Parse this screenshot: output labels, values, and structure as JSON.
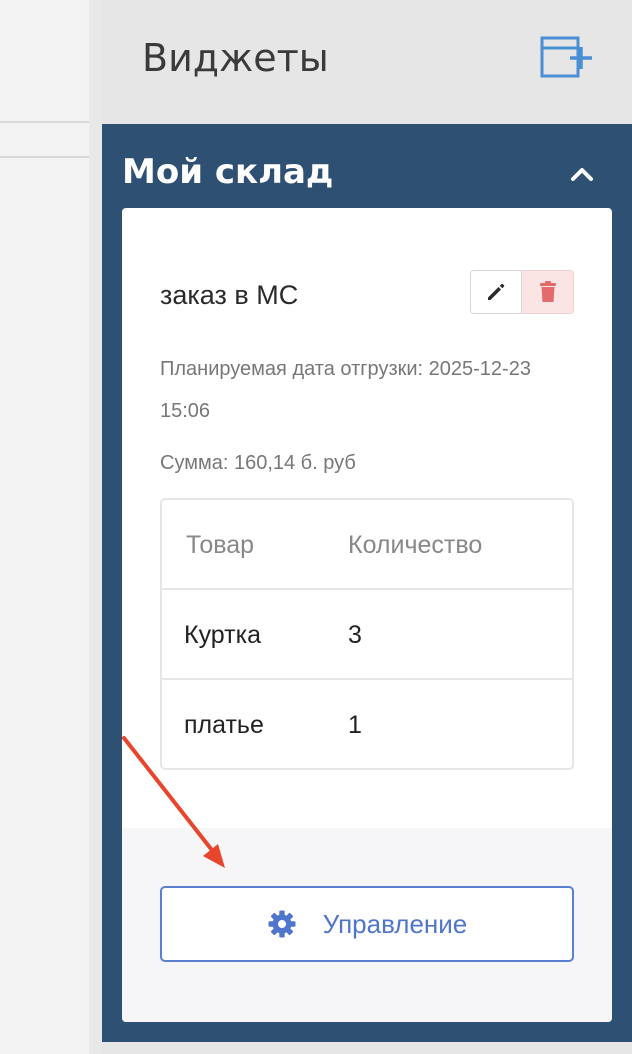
{
  "widgets_panel": {
    "title": "Виджеты"
  },
  "section": {
    "title": "Мой склад"
  },
  "order_card": {
    "title": "заказ в МС",
    "planned_date": "Планируемая дата отгрузки: 2025-12-23 15:06",
    "sum": "Сумма: 160,14 б. руб",
    "table": {
      "headers": [
        "Товар",
        "Количество"
      ],
      "rows": [
        [
          "Куртка",
          "3"
        ],
        [
          "платье",
          "1"
        ]
      ]
    },
    "manage_label": "Управление"
  },
  "colors": {
    "section_bg": "#2e5072",
    "accent": "#4f75cc",
    "danger": "#e36b6b"
  }
}
